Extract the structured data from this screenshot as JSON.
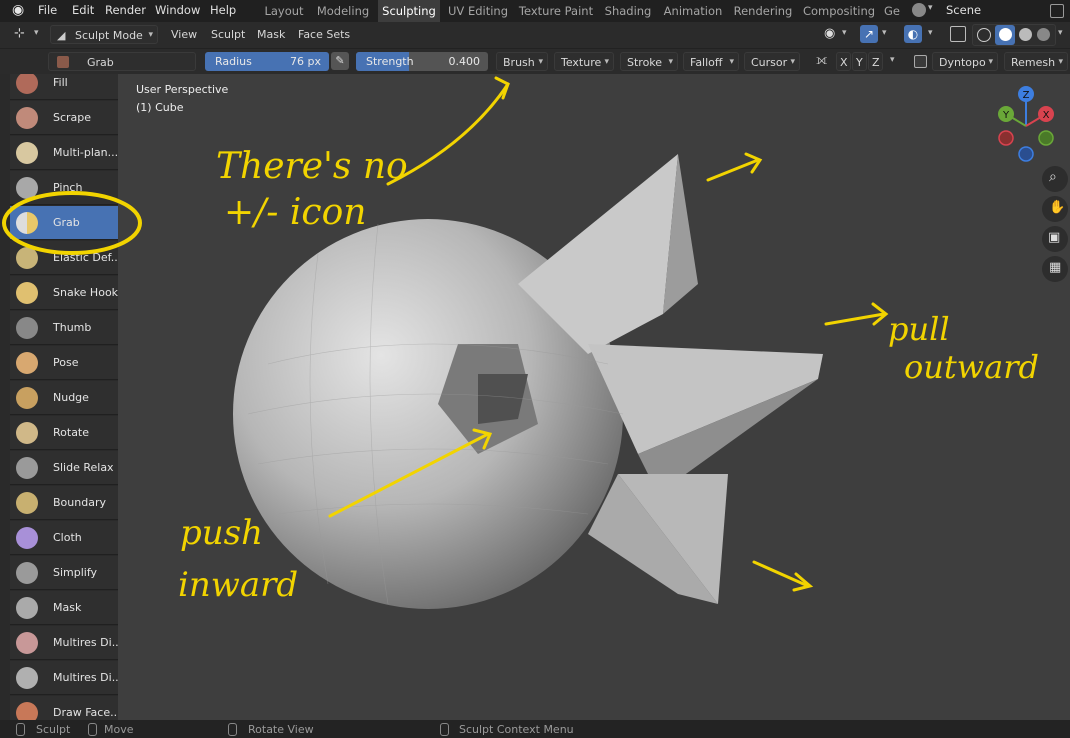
{
  "menu": {
    "items": [
      "File",
      "Edit",
      "Render",
      "Window",
      "Help"
    ]
  },
  "workspaces": {
    "tabs": [
      "Layout",
      "Modeling",
      "Sculpting",
      "UV Editing",
      "Texture Paint",
      "Shading",
      "Animation",
      "Rendering",
      "Compositing",
      "Ge"
    ],
    "active": "Sculpting"
  },
  "scene": {
    "name": "Scene"
  },
  "header": {
    "mode": "Sculpt Mode",
    "menus": [
      "View",
      "Sculpt",
      "Mask",
      "Face Sets"
    ]
  },
  "tool_settings": {
    "brush_name": "Grab",
    "radius_label": "Radius",
    "radius_value": "76 px",
    "strength_label": "Strength",
    "strength_value": "0.400",
    "dropdowns": [
      "Brush",
      "Texture",
      "Stroke",
      "Falloff",
      "Cursor"
    ],
    "axes": [
      "X",
      "Y",
      "Z"
    ],
    "dyntopo": "Dyntopo",
    "remesh": "Remesh"
  },
  "toolbar": {
    "tools": [
      "Fill",
      "Scrape",
      "Multi-plan...",
      "Pinch",
      "Grab",
      "Elastic Def...",
      "Snake Hook",
      "Thumb",
      "Pose",
      "Nudge",
      "Rotate",
      "Slide Relax",
      "Boundary",
      "Cloth",
      "Simplify",
      "Mask",
      "Multires Di...",
      "Multires Di...",
      "Draw Face..."
    ],
    "active": "Grab"
  },
  "viewport": {
    "perspective": "User Perspective",
    "object": "(1) Cube"
  },
  "gizmo": {
    "axes": [
      "Z",
      "Y",
      "X"
    ]
  },
  "annotations": {
    "note_line1": "There's no",
    "note_line2": "+/- icon",
    "pull_line1": "pull",
    "pull_line2": "outward",
    "push_line1": "push",
    "push_line2": "inward"
  },
  "status": {
    "items": [
      "Sculpt",
      "Move",
      "Rotate View",
      "Sculpt Context Menu"
    ]
  },
  "colors": {
    "accent": "#4772b3",
    "annotation": "#f2d400",
    "viewport_bg": "#3e3e3e"
  }
}
